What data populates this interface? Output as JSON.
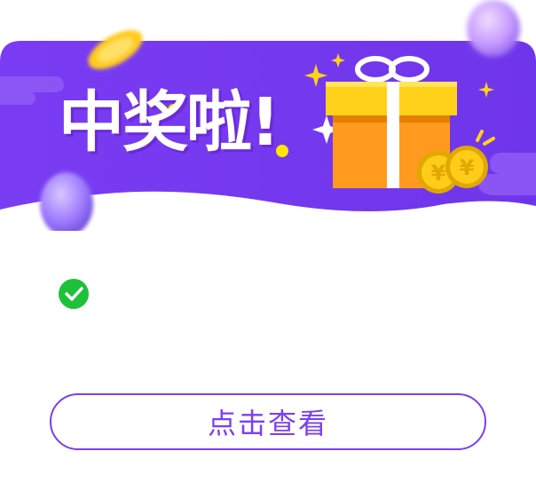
{
  "banner": {
    "title": "中奖啦!",
    "colors": {
      "primary": "#7b3ff2",
      "wave_light": "#8e5bf5",
      "box": "#ff9a1f",
      "lid": "#ffd11a",
      "ribbon": "#ffffff",
      "coin": "#ffcc1a"
    },
    "decorations": [
      "gift-box-icon",
      "coin-icon",
      "balloon-icon",
      "sparkle-icon"
    ]
  },
  "result": {
    "icon": "check-circle-icon",
    "check_color": "#1ec13a",
    "message": ""
  },
  "actions": {
    "view_label": "点击查看"
  }
}
